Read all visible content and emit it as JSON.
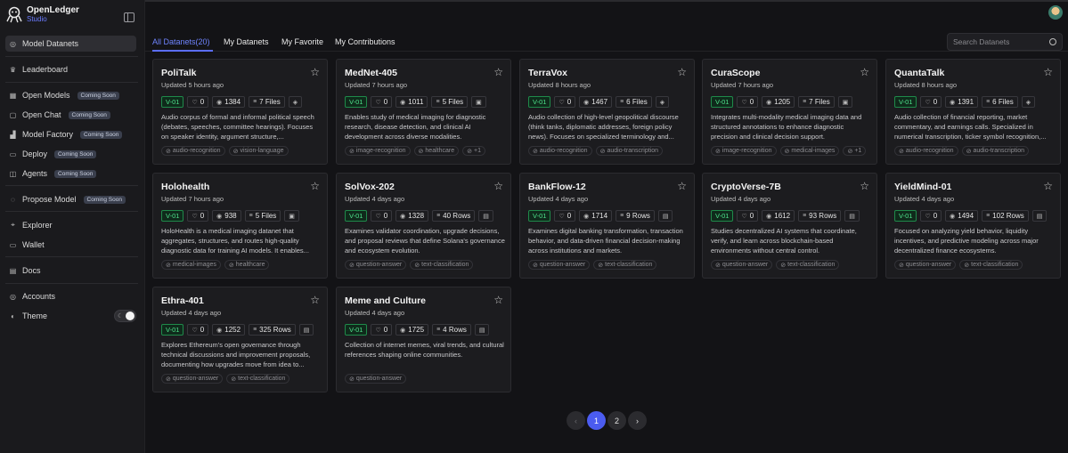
{
  "brand": {
    "name": "OpenLedger",
    "sub": "Studio"
  },
  "sidebar": {
    "items": [
      {
        "label": "Model Datanets",
        "icon": "database-icon",
        "soon": ""
      },
      {
        "label": "Leaderboard",
        "icon": "crown-icon",
        "soon": ""
      },
      {
        "label": "Open Models",
        "icon": "grid-icon",
        "soon": "Coming Soon"
      },
      {
        "label": "Open Chat",
        "icon": "chat-icon",
        "soon": "Coming Soon"
      },
      {
        "label": "Model Factory",
        "icon": "factory-icon",
        "soon": "Coming Soon"
      },
      {
        "label": "Deploy",
        "icon": "truck-icon",
        "soon": "Coming Soon"
      },
      {
        "label": "Agents",
        "icon": "robot-icon",
        "soon": "Coming Soon"
      },
      {
        "label": "Propose Model",
        "icon": "bulb-icon",
        "soon": "Coming Soon"
      },
      {
        "label": "Explorer",
        "icon": "compass-icon",
        "soon": ""
      },
      {
        "label": "Wallet",
        "icon": "wallet-icon",
        "soon": ""
      },
      {
        "label": "Docs",
        "icon": "docs-icon",
        "soon": ""
      },
      {
        "label": "Accounts",
        "icon": "accounts-icon",
        "soon": ""
      },
      {
        "label": "Theme",
        "icon": "palette-icon",
        "soon": ""
      }
    ]
  },
  "tabs": [
    {
      "label": "All Datanets(20)"
    },
    {
      "label": "My Datanets"
    },
    {
      "label": "My Favorite"
    },
    {
      "label": "My Contributions"
    }
  ],
  "search": {
    "placeholder": "Search Datanets"
  },
  "cards": [
    {
      "title": "PoliTalk",
      "updated": "Updated 5 hours ago",
      "version": "V-01",
      "likes": "0",
      "views": "1384",
      "count": "7 Files",
      "type_icon": "audio-icon",
      "desc": "Audio corpus of formal and informal political speech (debates, speeches, committee hearings). Focuses on speaker identity, argument structure,...",
      "tags": [
        "audio-recognition",
        "vision-language"
      ]
    },
    {
      "title": "MedNet-405",
      "updated": "Updated 7 hours ago",
      "version": "V-01",
      "likes": "0",
      "views": "1011",
      "count": "5 Files",
      "type_icon": "image-icon",
      "desc": "Enables study of medical imaging for diagnostic research, disease detection, and clinical AI development across diverse modalities.",
      "tags": [
        "image-recognition",
        "healthcare",
        "+1"
      ]
    },
    {
      "title": "TerraVox",
      "updated": "Updated 8 hours ago",
      "version": "V-01",
      "likes": "0",
      "views": "1467",
      "count": "6 Files",
      "type_icon": "audio-icon",
      "desc": "Audio collection of high-level geopolitical discourse (think tanks, diplomatic addresses, foreign policy news). Focuses on specialized terminology and...",
      "tags": [
        "audio-recognition",
        "audio-transcription"
      ]
    },
    {
      "title": "CuraScope",
      "updated": "Updated 7 hours ago",
      "version": "V-01",
      "likes": "0",
      "views": "1205",
      "count": "7 Files",
      "type_icon": "image-icon",
      "desc": "Integrates multi-modality medical imaging data and structured annotations to enhance diagnostic precision and clinical decision support.",
      "tags": [
        "image-recognition",
        "medical-images",
        "+1"
      ]
    },
    {
      "title": "QuantaTalk",
      "updated": "Updated 8 hours ago",
      "version": "V-01",
      "likes": "0",
      "views": "1391",
      "count": "6 Files",
      "type_icon": "audio-icon",
      "desc": "Audio collection of financial reporting, market commentary, and earnings calls. Specialized in numerical transcription, ticker symbol recognition,...",
      "tags": [
        "audio-recognition",
        "audio-transcription"
      ]
    },
    {
      "title": "Holohealth",
      "updated": "Updated 7 hours ago",
      "version": "V-01",
      "likes": "0",
      "views": "938",
      "count": "5 Files",
      "type_icon": "image-icon",
      "desc": "HoloHealth is a medical imaging datanet that aggregates, structures, and routes high-quality diagnostic data for training AI models. It enables...",
      "tags": [
        "medical-images",
        "healthcare"
      ]
    },
    {
      "title": "SolVox-202",
      "updated": "Updated 4 days ago",
      "version": "V-01",
      "likes": "0",
      "views": "1328",
      "count": "40 Rows",
      "type_icon": "doc-icon",
      "desc": "Examines validator coordination, upgrade decisions, and proposal reviews that define Solana's governance and ecosystem evolution.",
      "tags": [
        "question-answer",
        "text-classification"
      ]
    },
    {
      "title": "BankFlow-12",
      "updated": "Updated 4 days ago",
      "version": "V-01",
      "likes": "0",
      "views": "1714",
      "count": "9 Rows",
      "type_icon": "doc-icon",
      "desc": "Examines digital banking transformation, transaction behavior, and data-driven financial decision-making across institutions and markets.",
      "tags": [
        "question-answer",
        "text-classification"
      ]
    },
    {
      "title": "CryptoVerse-7B",
      "updated": "Updated 4 days ago",
      "version": "V-01",
      "likes": "0",
      "views": "1612",
      "count": "93 Rows",
      "type_icon": "doc-icon",
      "desc": "Studies decentralized AI systems that coordinate, verify, and learn across blockchain-based environments without central control.",
      "tags": [
        "question-answer",
        "text-classification"
      ]
    },
    {
      "title": "YieldMind-01",
      "updated": "Updated 4 days ago",
      "version": "V-01",
      "likes": "0",
      "views": "1494",
      "count": "102 Rows",
      "type_icon": "doc-icon",
      "desc": "Focused on analyzing yield behavior, liquidity incentives, and predictive modeling across major decentralized finance ecosystems.",
      "tags": [
        "question-answer",
        "text-classification"
      ]
    },
    {
      "title": "Ethra-401",
      "updated": "Updated 4 days ago",
      "version": "V-01",
      "likes": "0",
      "views": "1252",
      "count": "325 Rows",
      "type_icon": "doc-icon",
      "desc": "Explores Ethereum's open governance through technical discussions and improvement proposals, documenting how upgrades move from idea to...",
      "tags": [
        "question-answer",
        "text-classification"
      ]
    },
    {
      "title": "Meme and Culture",
      "updated": "Updated 4 days ago",
      "version": "V-01",
      "likes": "0",
      "views": "1725",
      "count": "4 Rows",
      "type_icon": "doc-icon",
      "desc": "Collection of internet memes, viral trends, and cultural references shaping online communities.",
      "tags": [
        "question-answer"
      ]
    }
  ],
  "pagination": {
    "prev": "‹",
    "pages": [
      "1",
      "2"
    ],
    "next": "›",
    "current": "1"
  },
  "colors": {
    "accent": "#4b5cf0",
    "version_green": "#4ee08a",
    "bg": "#131316"
  }
}
